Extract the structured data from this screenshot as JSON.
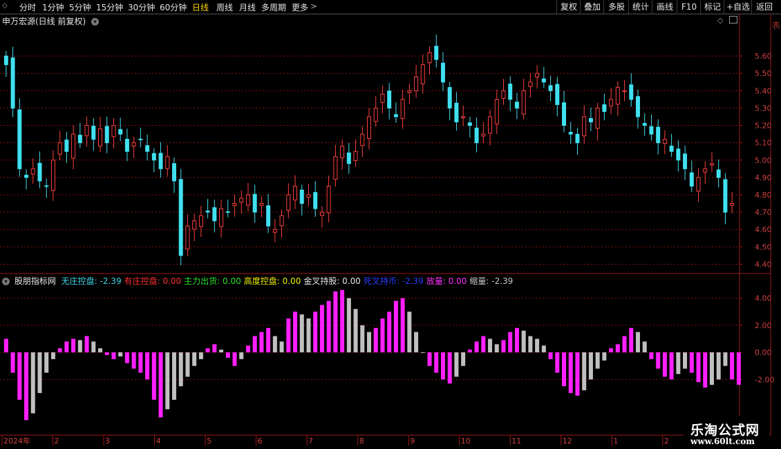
{
  "toolbar": {
    "periods": [
      "分时",
      "1分钟",
      "5分钟",
      "15分钟",
      "30分钟",
      "60分钟",
      "日线",
      "周线",
      "月线",
      "多周期",
      "更多"
    ],
    "active_period": "日线",
    "right_buttons": [
      "复权",
      "叠加",
      "多股",
      "统计",
      "画线",
      "F10",
      "标记",
      "+自选",
      "返回"
    ]
  },
  "main_panel": {
    "title": "申万宏源(日线 前复权)",
    "price_axis": [
      "5.60",
      "5.50",
      "5.40",
      "5.30",
      "5.20",
      "5.10",
      "5.00",
      "4.90",
      "4.80",
      "4.70",
      "4.60",
      "4.50",
      "4.40"
    ],
    "right_strip_label": "表"
  },
  "indicator_panel": {
    "name": "股朋指标网",
    "fields": [
      {
        "label": "无庄控盘:",
        "value": "-2.39",
        "color": "#40d8e8"
      },
      {
        "label": "有庄控盘:",
        "value": "0.00",
        "color": "#ff3030"
      },
      {
        "label": "主力出货:",
        "value": "0.00",
        "color": "#30e030"
      },
      {
        "label": "高度控盘:",
        "value": "0.00",
        "color": "#f0f000"
      },
      {
        "label": "金叉持股:",
        "value": "0.00",
        "color": "#e8e8e8"
      },
      {
        "label": "死叉持币:",
        "value": "-2.39",
        "color": "#2a3cff"
      },
      {
        "label": "放量:",
        "value": "0.00",
        "color": "#ff30ff"
      },
      {
        "label": "缩量:",
        "value": "-2.39",
        "color": "#c8c8c8"
      }
    ],
    "axis": [
      "4.00",
      "2.00",
      "0.00",
      "-2.00"
    ]
  },
  "date_axis": [
    "2024年",
    "2",
    "3",
    "4",
    "5",
    "6",
    "7",
    "8",
    "9",
    "10",
    "11",
    "12",
    "1",
    "2"
  ],
  "watermark": {
    "line1": "乐淘公式网",
    "line2": "www.60lt.com"
  },
  "colors": {
    "up": "#ff4040",
    "down": "#40e0f0",
    "magenta": "#ff20ff",
    "gray": "#c0c0c0",
    "grid": "#8a1010"
  },
  "chart_data": {
    "type": "candlestick",
    "close_prices": [
      5.55,
      5.3,
      4.95,
      4.9,
      4.95,
      4.88,
      4.85,
      5.0,
      5.1,
      5.05,
      5.15,
      5.1,
      5.2,
      5.12,
      5.18,
      5.1,
      5.2,
      5.15,
      5.05,
      5.1,
      5.12,
      5.05,
      5.0,
      4.95,
      5.02,
      4.88,
      4.45,
      4.62,
      4.65,
      4.68,
      4.7,
      4.65,
      4.72,
      4.7,
      4.75,
      4.78,
      4.8,
      4.7,
      4.75,
      4.62,
      4.6,
      4.68,
      4.8,
      4.85,
      4.75,
      4.8,
      4.72,
      4.7,
      4.85,
      5.02,
      5.08,
      4.98,
      5.05,
      5.15,
      5.25,
      5.3,
      5.38,
      5.3,
      5.25,
      5.35,
      5.4,
      5.48,
      5.55,
      5.62,
      5.58,
      5.45,
      5.3,
      5.22,
      5.25,
      5.2,
      5.1,
      5.15,
      5.25,
      5.35,
      5.4,
      5.35,
      5.3,
      5.4,
      5.45,
      5.5,
      5.45,
      5.4,
      5.32,
      5.2,
      5.15,
      5.1,
      5.25,
      5.22,
      5.3,
      5.28,
      5.35,
      5.42,
      5.4,
      5.35,
      5.25,
      5.2,
      5.15,
      5.1,
      5.12,
      5.05,
      5.0,
      4.95,
      4.85,
      4.9,
      4.95,
      4.98,
      4.9,
      4.7,
      4.75
    ],
    "indicator_values": [
      1.0,
      -1.5,
      -3.5,
      -5.0,
      -4.5,
      -3.0,
      -1.5,
      -0.5,
      0.3,
      0.8,
      1.0,
      0.9,
      1.2,
      0.8,
      0.3,
      -0.2,
      -0.5,
      -0.3,
      -0.8,
      -1.2,
      -1.5,
      -2.0,
      -3.5,
      -4.8,
      -4.2,
      -3.5,
      -2.5,
      -1.8,
      -1.0,
      -0.5,
      0.3,
      0.6,
      0.2,
      -0.4,
      -1.0,
      -0.5,
      0.5,
      1.2,
      1.5,
      1.8,
      1.2,
      0.8,
      2.5,
      3.0,
      2.8,
      2.5,
      3.0,
      3.5,
      3.8,
      4.5,
      4.6,
      4.0,
      3.2,
      2.0,
      1.5,
      1.8,
      2.5,
      3.0,
      3.8,
      4.0,
      3.0,
      1.5,
      0.0,
      -1.0,
      -1.5,
      -2.0,
      -2.3,
      -1.8,
      -1.0,
      0.2,
      0.8,
      1.2,
      1.0,
      0.6,
      0.9,
      1.5,
      1.8,
      1.6,
      1.2,
      1.0,
      0.5,
      -0.5,
      -1.5,
      -2.5,
      -3.0,
      -3.2,
      -2.8,
      -2.0,
      -1.2,
      -0.6,
      0.3,
      0.6,
      1.2,
      1.8,
      1.5,
      0.8,
      -0.5,
      -1.2,
      -1.8,
      -2.0,
      -1.6,
      -1.2,
      -1.5,
      -2.2,
      -2.6,
      -2.4,
      -2.0,
      -1.0,
      -2.0,
      -2.39
    ]
  }
}
